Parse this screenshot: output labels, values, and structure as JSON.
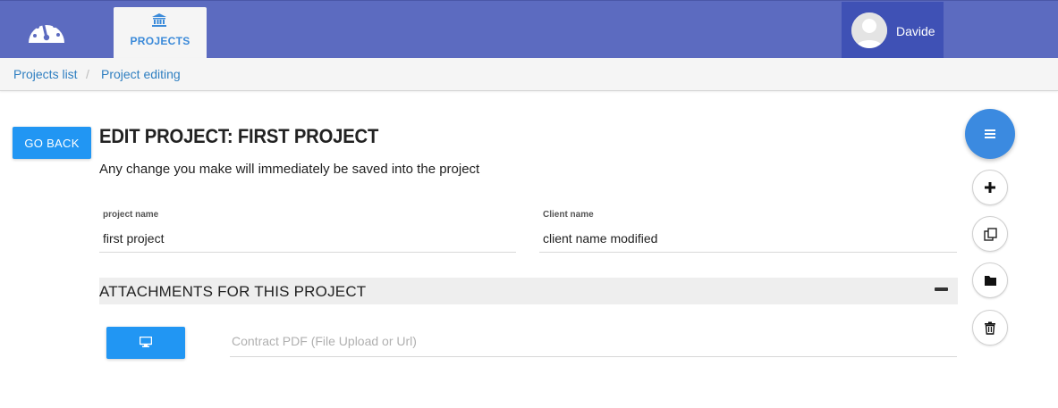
{
  "navbar": {
    "logo_icon": "dashboard-gauge-icon",
    "tab_icon": "bank-icon",
    "projects_tab": "PROJECTS",
    "user_name": "Davide",
    "colors": {
      "bar": "#5c6bc0",
      "user_box": "#3f51b5",
      "accent": "#2196f3"
    }
  },
  "breadcrumb": {
    "items": [
      "Projects list",
      "Project editing"
    ],
    "separator": "/"
  },
  "main": {
    "go_back": "GO BACK",
    "title": "EDIT PROJECT: FIRST PROJECT",
    "subtitle": "Any change you make will immediately be saved into the project",
    "fields": {
      "project_name": {
        "label": "project name",
        "value": "first project"
      },
      "client_name": {
        "label": "Client name",
        "value": "client name modified"
      }
    },
    "attachments": {
      "title": "ATTACHMENTS FOR THIS PROJECT",
      "upload_icon": "monitor-icon",
      "contract_placeholder": "Contract PDF (File Upload or Url)"
    }
  },
  "fab": {
    "main_icon": "menu-icon",
    "actions": [
      "plus-icon",
      "copy-icon",
      "folder-icon",
      "trash-icon"
    ]
  }
}
